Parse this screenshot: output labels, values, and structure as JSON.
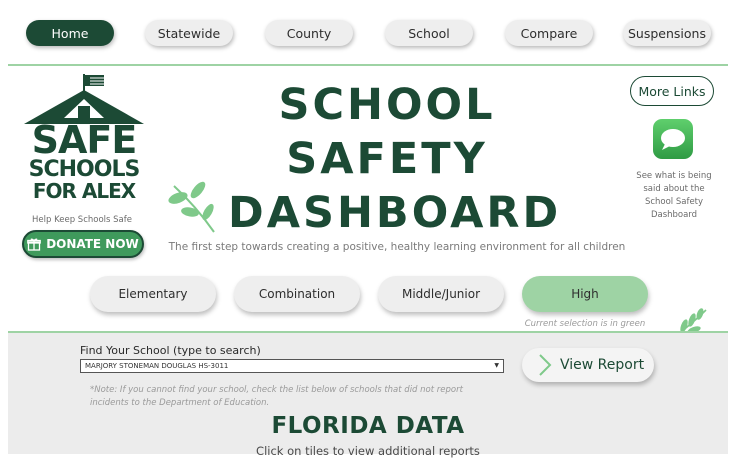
{
  "nav": {
    "items": [
      {
        "label": "Home",
        "active": true
      },
      {
        "label": "Statewide",
        "active": false
      },
      {
        "label": "County",
        "active": false
      },
      {
        "label": "School",
        "active": false
      },
      {
        "label": "Compare",
        "active": false
      },
      {
        "label": "Suspensions",
        "active": false
      }
    ]
  },
  "logo": {
    "lines": [
      "SAFE",
      "SCHOOLS",
      "FOR ALEX"
    ],
    "tagline": "Help Keep Schools Safe",
    "donate_label": "DONATE NOW"
  },
  "title": {
    "lines": [
      "SCHOOL",
      "SAFETY",
      "DASHBOARD"
    ],
    "subtitle": "The first step towards creating a positive, healthy learning environment for all children"
  },
  "right": {
    "more_links_label": "More Links",
    "message_note": "See what is being said about the School Safety Dashboard"
  },
  "levels": {
    "items": [
      {
        "label": "Elementary",
        "active": false
      },
      {
        "label": "Combination",
        "active": false
      },
      {
        "label": "Middle/Junior",
        "active": false
      },
      {
        "label": "High",
        "active": true
      }
    ],
    "selection_note": "Current selection is in green"
  },
  "search": {
    "label": "Find Your School (type to search)",
    "selected_value": "MARJORY STONEMAN DOUGLAS HS-3011",
    "note": "*Note: If you cannot find your school, check the list below of schools that did not report incidents to the Department of Education.",
    "view_report_label": "View Report"
  },
  "florida": {
    "heading": "FLORIDA DATA",
    "subheading": "Click on tiles to view additional reports"
  },
  "colors": {
    "brand_dark": "#1c4a35",
    "accent_green": "#9ed3a4",
    "donate_green": "#3f9a5c"
  }
}
